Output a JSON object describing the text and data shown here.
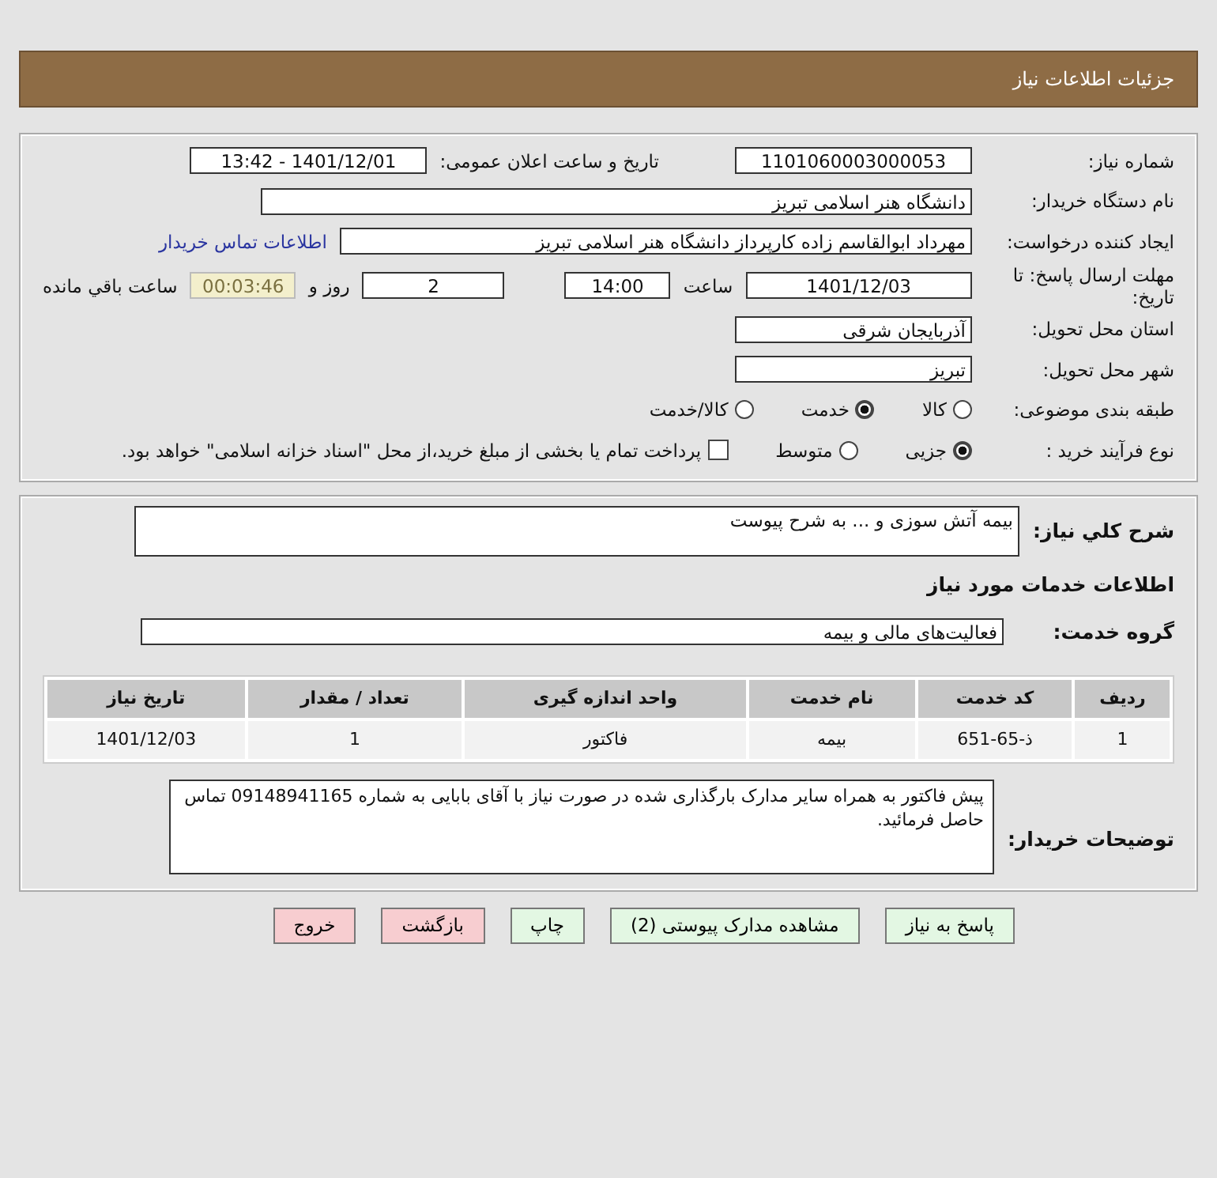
{
  "header": {
    "title": "جزئیات اطلاعات نیاز"
  },
  "need_number": {
    "label": "شماره نیاز:",
    "value": "1101060003000053"
  },
  "announce": {
    "label": "تاریخ و ساعت اعلان عمومی:",
    "value": "1401/12/01 - 13:42"
  },
  "buyer": {
    "label": "نام دستگاه خریدار:",
    "value": "دانشگاه هنر اسلامی تبریز"
  },
  "requester": {
    "label": "ایجاد کننده درخواست:",
    "value": "مهرداد ابوالقاسم زاده کارپرداز دانشگاه هنر اسلامی تبریز",
    "link": "اطلاعات تماس خریدار"
  },
  "deadline": {
    "label": "مهلت ارسال پاسخ: تا تاریخ:",
    "date": "1401/12/03",
    "time_label": "ساعت",
    "time": "14:00",
    "days": "2",
    "days_label": "روز و",
    "remaining": "00:03:46",
    "remaining_label": "ساعت باقي مانده"
  },
  "province": {
    "label": "استان محل تحویل:",
    "value": "آذربایجان شرقی"
  },
  "city": {
    "label": "شهر محل تحویل:",
    "value": "تبریز"
  },
  "category": {
    "label": "طبقه بندی موضوعی:",
    "options": [
      {
        "label": "کالا",
        "selected": false
      },
      {
        "label": "خدمت",
        "selected": true
      },
      {
        "label": "کالا/خدمت",
        "selected": false
      }
    ]
  },
  "purchase_type": {
    "label": "نوع فرآیند خرید :",
    "options": [
      {
        "label": "جزیی",
        "selected": true
      },
      {
        "label": "متوسط",
        "selected": false
      }
    ],
    "checkbox": {
      "label": "پرداخت تمام یا بخشی از مبلغ خرید،از محل \"اسناد خزانه اسلامی\" خواهد بود.",
      "checked": false
    }
  },
  "summary": {
    "label": "شرح کلي نیاز:",
    "value": "بیمه آتش سوزی و ... به شرح پیوست"
  },
  "section_title": "اطلاعات خدمات مورد نیاز",
  "service_group": {
    "label": "گروه خدمت:",
    "value": "فعالیت‌های مالی و بیمه"
  },
  "table": {
    "columns": [
      "ردیف",
      "کد خدمت",
      "نام خدمت",
      "واحد اندازه گیری",
      "تعداد / مقدار",
      "تاریخ نیاز"
    ],
    "rows": [
      [
        "1",
        "ذ-65-651",
        "بیمه",
        "فاکتور",
        "1",
        "1401/12/03"
      ]
    ]
  },
  "buyer_notes": {
    "label": "توضیحات خریدار:",
    "value": "پیش فاکتور به همراه سایر مدارک بارگذاری شده در صورت نیاز با آقای بابایی به شماره 09148941165 تماس حاصل فرمائید."
  },
  "buttons": [
    {
      "label": "پاسخ به نیاز",
      "kind": "primary"
    },
    {
      "label": "مشاهده مدارک پیوستی (2)",
      "kind": "primary"
    },
    {
      "label": "چاپ",
      "kind": "primary"
    },
    {
      "label": "بازگشت",
      "kind": "danger"
    },
    {
      "label": "خروج",
      "kind": "danger"
    }
  ]
}
